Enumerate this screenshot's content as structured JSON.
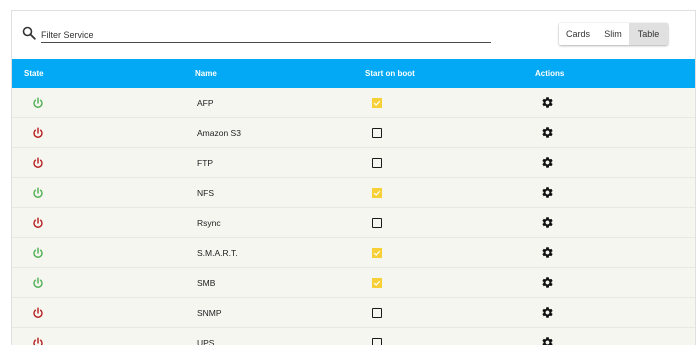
{
  "search": {
    "placeholder": "Filter Service",
    "value": ""
  },
  "view_toggle": {
    "cards": "Cards",
    "slim": "Slim",
    "table": "Table",
    "selected": "Table"
  },
  "table": {
    "columns": {
      "state": "State",
      "name": "Name",
      "boot": "Start on boot",
      "actions": "Actions"
    },
    "rows": [
      {
        "name": "AFP",
        "running": true,
        "boot": true
      },
      {
        "name": "Amazon S3",
        "running": false,
        "boot": false
      },
      {
        "name": "FTP",
        "running": false,
        "boot": false
      },
      {
        "name": "NFS",
        "running": true,
        "boot": true
      },
      {
        "name": "Rsync",
        "running": false,
        "boot": false
      },
      {
        "name": "S.M.A.R.T.",
        "running": true,
        "boot": true
      },
      {
        "name": "SMB",
        "running": true,
        "boot": true
      },
      {
        "name": "SNMP",
        "running": false,
        "boot": false
      },
      {
        "name": "UPS",
        "running": false,
        "boot": false
      }
    ]
  },
  "colors": {
    "accent": "#03a9f4",
    "running": "#4caf50",
    "stopped": "#b71c1c",
    "checkbox_checked": "#f7cf36",
    "row_bg": "#f6f6f1"
  }
}
